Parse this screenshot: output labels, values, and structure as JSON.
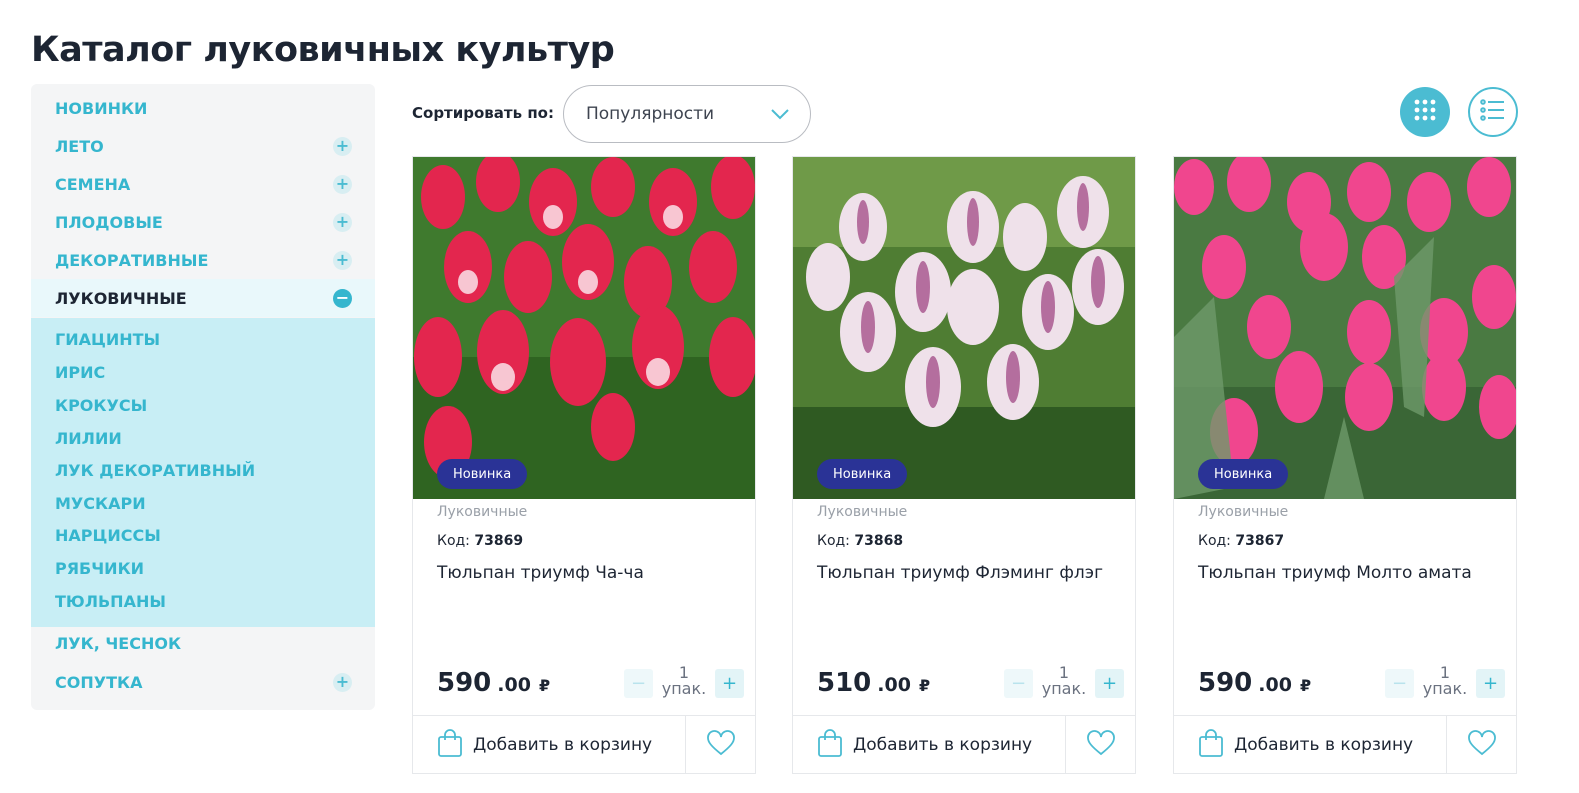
{
  "page": {
    "title": "Каталог луковичных культур"
  },
  "sidebar": {
    "items": [
      {
        "label": "НОВИНКИ"
      },
      {
        "label": "ЛЕТО"
      },
      {
        "label": "СЕМЕНА"
      },
      {
        "label": "ПЛОДОВЫЕ"
      },
      {
        "label": "ДЕКОРАТИВНЫЕ"
      },
      {
        "label": "ЛУКОВИЧНЫЕ"
      },
      {
        "label": "ЛУК, ЧЕСНОК"
      },
      {
        "label": "СОПУТКА"
      }
    ],
    "subitems": [
      {
        "label": "ГИАЦИНТЫ"
      },
      {
        "label": "ИРИС"
      },
      {
        "label": "КРОКУСЫ"
      },
      {
        "label": "ЛИЛИИ"
      },
      {
        "label": "ЛУК ДЕКОРАТИВНЫЙ"
      },
      {
        "label": "МУСКАРИ"
      },
      {
        "label": "НАРЦИССЫ"
      },
      {
        "label": "РЯБЧИКИ"
      },
      {
        "label": "ТЮЛЬПАНЫ"
      }
    ],
    "plus_symbol": "+",
    "minus_symbol": "−"
  },
  "toolbar": {
    "sort_label": "Сортировать по:",
    "sort_value": "Популярности"
  },
  "products": [
    {
      "badge": "Новинка",
      "category": "Луковичные",
      "code_label": "Код:",
      "code": "73869",
      "name": "Тюльпан триумф Ча-ча",
      "price_main": "590",
      "price_cents": ".00",
      "currency": "₽",
      "qty": "1",
      "qty_unit": "упак.",
      "add_to_cart": "Добавить в корзину"
    },
    {
      "badge": "Новинка",
      "category": "Луковичные",
      "code_label": "Код:",
      "code": "73868",
      "name": "Тюльпан триумф Флэминг флэг",
      "price_main": "510",
      "price_cents": ".00",
      "currency": "₽",
      "qty": "1",
      "qty_unit": "упак.",
      "add_to_cart": "Добавить в корзину"
    },
    {
      "badge": "Новинка",
      "category": "Луковичные",
      "code_label": "Код:",
      "code": "73867",
      "name": "Тюльпан триумф Молто амата",
      "price_main": "590",
      "price_cents": ".00",
      "currency": "₽",
      "qty": "1",
      "qty_unit": "упак.",
      "add_to_cart": "Добавить в корзину"
    }
  ],
  "qty_controls": {
    "minus": "−",
    "plus": "+"
  },
  "colors": {
    "accent": "#35b6ce",
    "badge": "#2a3396",
    "text": "#1d2533"
  },
  "icons": {
    "view_grid": "grid-icon",
    "view_list": "list-icon",
    "sort_chevron": "chevron-down-icon",
    "cart": "shopping-bag-icon",
    "favorite": "heart-icon"
  }
}
